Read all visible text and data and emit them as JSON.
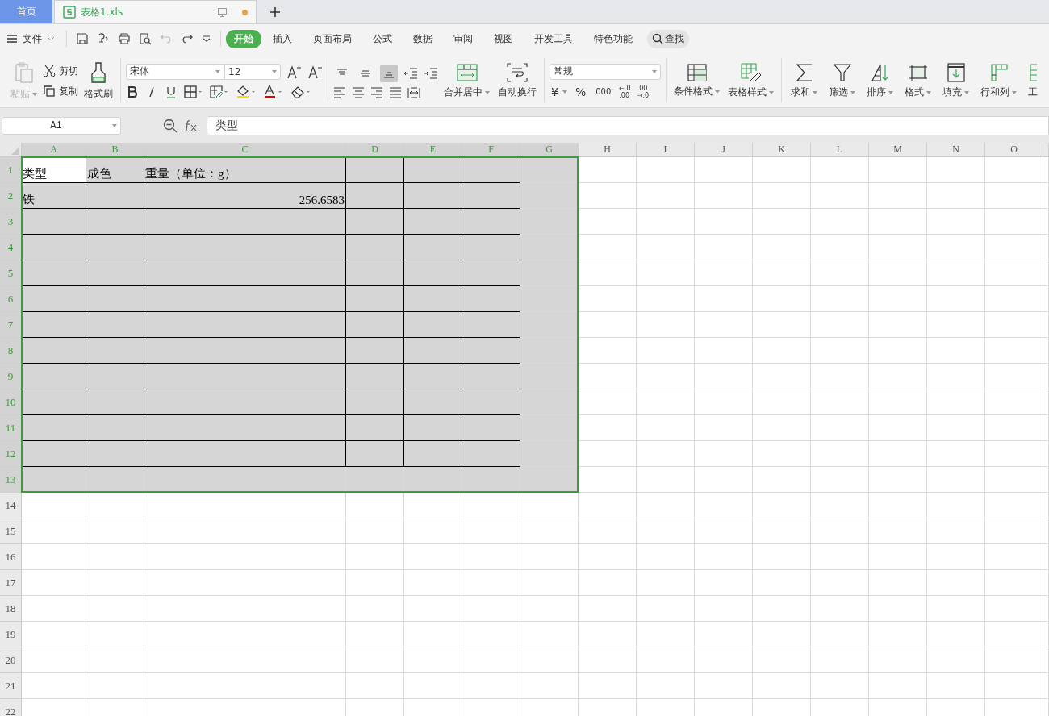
{
  "tabs": [
    {
      "label": "首页",
      "kind": "home",
      "selected": false
    },
    {
      "label": "表格1.xls",
      "kind": "document",
      "selected": true,
      "unsaved": true
    }
  ],
  "menu": {
    "file": "文件",
    "tabs": [
      {
        "label": "开始",
        "selected": true
      },
      {
        "label": "插入",
        "selected": false
      },
      {
        "label": "页面布局",
        "selected": false
      },
      {
        "label": "公式",
        "selected": false
      },
      {
        "label": "数据",
        "selected": false
      },
      {
        "label": "审阅",
        "selected": false
      },
      {
        "label": "视图",
        "selected": false
      },
      {
        "label": "开发工具",
        "selected": false
      },
      {
        "label": "特色功能",
        "selected": false
      }
    ],
    "search": "查找"
  },
  "ribbon": {
    "clipboard": [
      {
        "label": "粘贴",
        "disabled": true
      },
      {
        "label": "剪切",
        "disabled": false
      },
      {
        "label": "复制",
        "disabled": false
      },
      {
        "label": "格式刷",
        "disabled": false
      }
    ],
    "font": {
      "name": "宋体",
      "size": "12"
    },
    "vertical_align": [
      {
        "selected": false
      },
      {
        "selected": false
      },
      {
        "selected": true
      }
    ],
    "wrap": [
      "合并居中",
      "自动换行"
    ],
    "number_format": "常规",
    "number_buttons": [
      "¥",
      "%",
      "000"
    ],
    "decimal_buttons": [
      {
        "top": "←.0",
        "bottom": ".00"
      },
      {
        "top": ".00",
        "bottom": "→.0"
      }
    ],
    "styles": [
      "条件格式",
      "表格样式"
    ],
    "editing": [
      "求和",
      "筛选",
      "排序",
      "格式",
      "填充",
      "行和列",
      "工"
    ]
  },
  "formula_bar": {
    "cell": "A1",
    "value": "类型"
  },
  "sheet": {
    "columns": [
      {
        "label": "A",
        "selected": true,
        "bordered": true
      },
      {
        "label": "B",
        "selected": true,
        "bordered": true
      },
      {
        "label": "C",
        "selected": true,
        "bordered": true
      },
      {
        "label": "D",
        "selected": true,
        "bordered": true
      },
      {
        "label": "E",
        "selected": true,
        "bordered": true
      },
      {
        "label": "F",
        "selected": true,
        "bordered": true
      },
      {
        "label": "G",
        "selected": true,
        "bordered": false
      },
      {
        "label": "H",
        "selected": false,
        "bordered": false
      },
      {
        "label": "I",
        "selected": false,
        "bordered": false
      },
      {
        "label": "J",
        "selected": false,
        "bordered": false
      },
      {
        "label": "K",
        "selected": false,
        "bordered": false
      },
      {
        "label": "L",
        "selected": false,
        "bordered": false
      },
      {
        "label": "M",
        "selected": false,
        "bordered": false
      },
      {
        "label": "N",
        "selected": false,
        "bordered": false
      },
      {
        "label": "O",
        "selected": false,
        "bordered": false
      }
    ],
    "rows": [
      {
        "label": "1",
        "selected": true,
        "bordered": true,
        "cells": [
          {
            "text": "类型",
            "kind": "text",
            "active": true
          },
          {
            "text": "成色",
            "kind": "text",
            "active": false
          },
          {
            "text": "重量（单位：g）",
            "kind": "text",
            "active": false
          }
        ]
      },
      {
        "label": "2",
        "selected": true,
        "bordered": true,
        "cells": [
          {
            "text": "铁",
            "kind": "text",
            "active": false
          },
          null,
          {
            "text": "256.6583",
            "kind": "number",
            "active": false
          }
        ]
      },
      {
        "label": "3",
        "selected": true,
        "bordered": true
      },
      {
        "label": "4",
        "selected": true,
        "bordered": true
      },
      {
        "label": "5",
        "selected": true,
        "bordered": true
      },
      {
        "label": "6",
        "selected": true,
        "bordered": true
      },
      {
        "label": "7",
        "selected": true,
        "bordered": true
      },
      {
        "label": "8",
        "selected": true,
        "bordered": true
      },
      {
        "label": "9",
        "selected": true,
        "bordered": true
      },
      {
        "label": "10",
        "selected": true,
        "bordered": true
      },
      {
        "label": "11",
        "selected": true,
        "bordered": true
      },
      {
        "label": "12",
        "selected": true,
        "bordered": true
      },
      {
        "label": "13",
        "selected": true,
        "bordered": false
      },
      {
        "label": "14",
        "selected": false,
        "bordered": false
      },
      {
        "label": "15",
        "selected": false,
        "bordered": false
      },
      {
        "label": "16",
        "selected": false,
        "bordered": false
      },
      {
        "label": "17",
        "selected": false,
        "bordered": false
      },
      {
        "label": "18",
        "selected": false,
        "bordered": false
      },
      {
        "label": "19",
        "selected": false,
        "bordered": false
      },
      {
        "label": "20",
        "selected": false,
        "bordered": false
      },
      {
        "label": "21",
        "selected": false,
        "bordered": false
      },
      {
        "label": "22",
        "selected": false,
        "bordered": false
      }
    ]
  }
}
